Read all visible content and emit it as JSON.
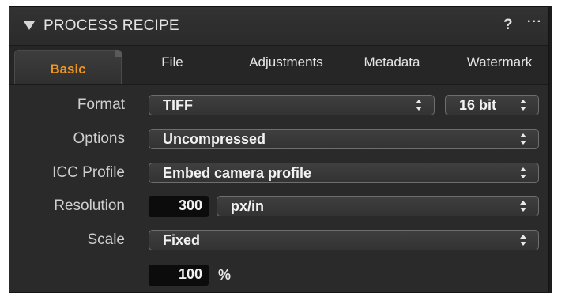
{
  "header": {
    "title": "PROCESS RECIPE",
    "help": "?",
    "more": "···",
    "collapse_icon": "triangle-down-icon"
  },
  "tabs": [
    {
      "label": "Basic",
      "active": true
    },
    {
      "label": "File",
      "active": false
    },
    {
      "label": "Adjustments",
      "active": false
    },
    {
      "label": "Metadata",
      "active": false
    },
    {
      "label": "Watermark",
      "active": false
    }
  ],
  "rows": {
    "format": {
      "label": "Format",
      "value": "TIFF",
      "bitdepth": "16 bit"
    },
    "options": {
      "label": "Options",
      "value": "Uncompressed"
    },
    "icc": {
      "label": "ICC Profile",
      "value": "Embed camera profile"
    },
    "resolution": {
      "label": "Resolution",
      "value": "300",
      "unit": "px/in"
    },
    "scale": {
      "label": "Scale",
      "value": "Fixed",
      "amount": "100",
      "unit": "%"
    }
  },
  "colors": {
    "accent": "#f0961e",
    "panel": "#2a2a2a",
    "text": "#e6e6e6"
  }
}
